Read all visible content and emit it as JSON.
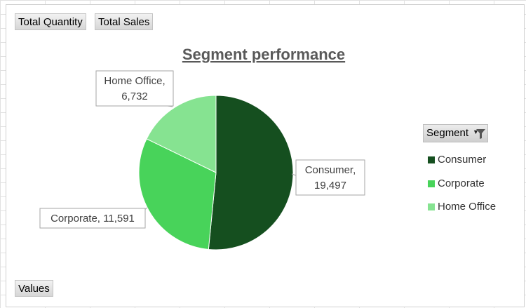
{
  "field_buttons": {
    "total_quantity": "Total Quantity",
    "total_sales": "Total Sales",
    "values": "Values"
  },
  "legend": {
    "header": "Segment",
    "header_icon": "filter-icon",
    "dropdown_icon": "dropdown-arrow-icon"
  },
  "chart_data": {
    "type": "pie",
    "title": "Segment performance",
    "categories": [
      "Consumer",
      "Corporate",
      "Home Office"
    ],
    "values": [
      19497,
      11591,
      6732
    ],
    "value_labels": [
      "19,497",
      "11,591",
      "6,732"
    ],
    "colors": [
      "#154f1f",
      "#48d35a",
      "#86e391"
    ],
    "legend_position": "right"
  }
}
